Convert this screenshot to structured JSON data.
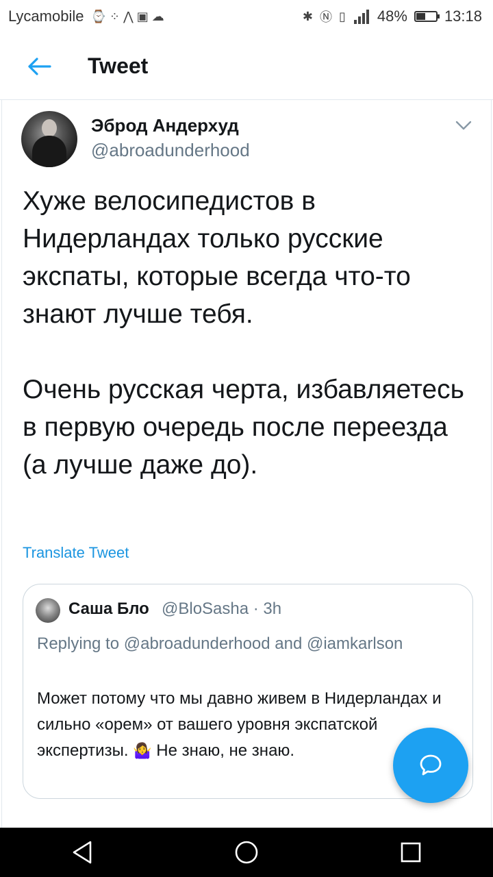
{
  "status_bar": {
    "carrier": "Lycamobile",
    "battery": "48%",
    "battery_level": 0.48,
    "time": "13:18",
    "icons": [
      "notification-icons",
      "bluetooth-icon",
      "nfc-icon",
      "vibrate-icon",
      "signal-icon",
      "battery-icon"
    ]
  },
  "header": {
    "title": "Tweet",
    "back_icon": "arrow-left-icon"
  },
  "tweet": {
    "author_name": "Эброд Андерхуд",
    "author_handle": "@abroadunderhood",
    "text": "Хуже велосипедистов в Нидерландах только русские экспаты, которые всегда что-то знают лучше тебя.\n\nОчень русская черта, избавляетесь в первую очередь после переезда (а лучше даже до).",
    "translate_label": "Translate Tweet"
  },
  "quoted_tweet": {
    "author_name": "Саша Бло",
    "author_handle": "@BloSasha · 3h",
    "replying_to": "Replying to @abroadunderhood and @iamkarlson",
    "text_before_emoji": "Может потому что мы  давно живем в Нидерландах и сильно «орем» от вашего уровня экспатской экспертизы. ",
    "emoji": "🤷‍♀️",
    "text_after_emoji": " Не знаю, не знаю."
  },
  "fab": {
    "icon": "reply-bubble-icon"
  },
  "colors": {
    "accent": "#1da1f2",
    "link": "#1b95e0",
    "secondary_text": "#657786",
    "nav_bar": "#000000"
  }
}
